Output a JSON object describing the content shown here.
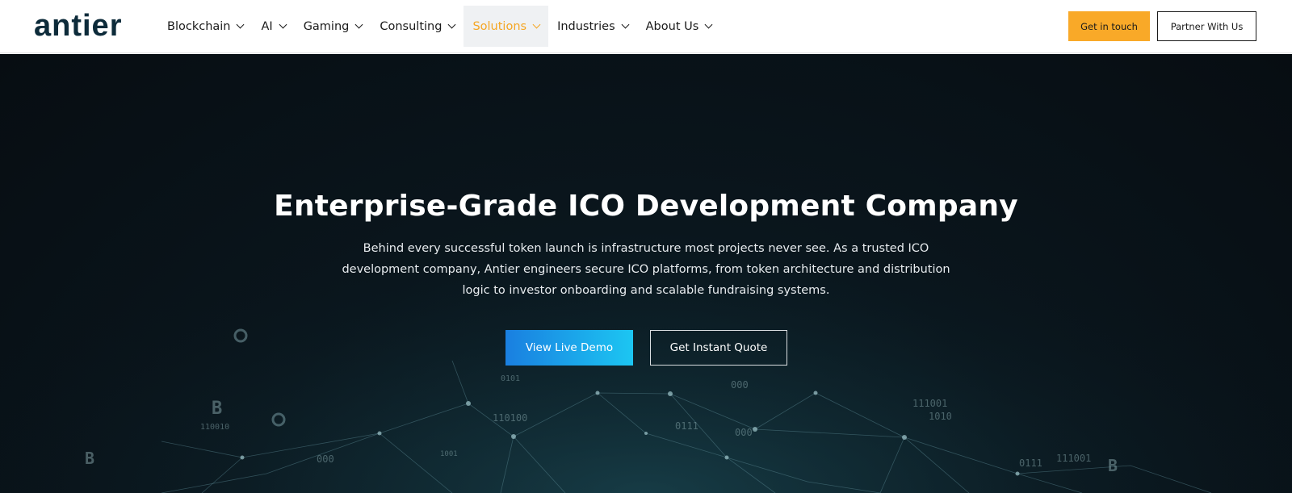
{
  "header": {
    "logo_text": "antier",
    "nav": [
      {
        "label": "Blockchain",
        "active": false
      },
      {
        "label": "AI",
        "active": false
      },
      {
        "label": "Gaming",
        "active": false
      },
      {
        "label": "Consulting",
        "active": false
      },
      {
        "label": "Solutions",
        "active": true
      },
      {
        "label": "Industries",
        "active": false
      },
      {
        "label": "About Us",
        "active": false
      }
    ],
    "cta_primary": "Get in touch",
    "cta_secondary": "Partner With Us"
  },
  "hero": {
    "title": "Enterprise-Grade ICO Development Company",
    "description": "Behind every successful token launch is infrastructure most projects never see. As a trusted ICO development company, Antier engineers secure ICO platforms, from token architecture and distribution logic to investor onboarding and scalable fundraising systems.",
    "button_demo": "View Live Demo",
    "button_quote": "Get Instant Quote",
    "decor_labels": [
      "B",
      "110010",
      "110100",
      "0101",
      "000",
      "0111",
      "000",
      "111001",
      "1010",
      "1001",
      "000",
      "0111",
      "111001",
      "B",
      "B"
    ]
  },
  "colors": {
    "accent_orange": "#f9a928",
    "nav_active": "#f5a623",
    "logo": "#0d2b3a",
    "hero_bg": "#070d12",
    "demo_gradient_start": "#1a7fe0",
    "demo_gradient_end": "#1cc6f2"
  }
}
